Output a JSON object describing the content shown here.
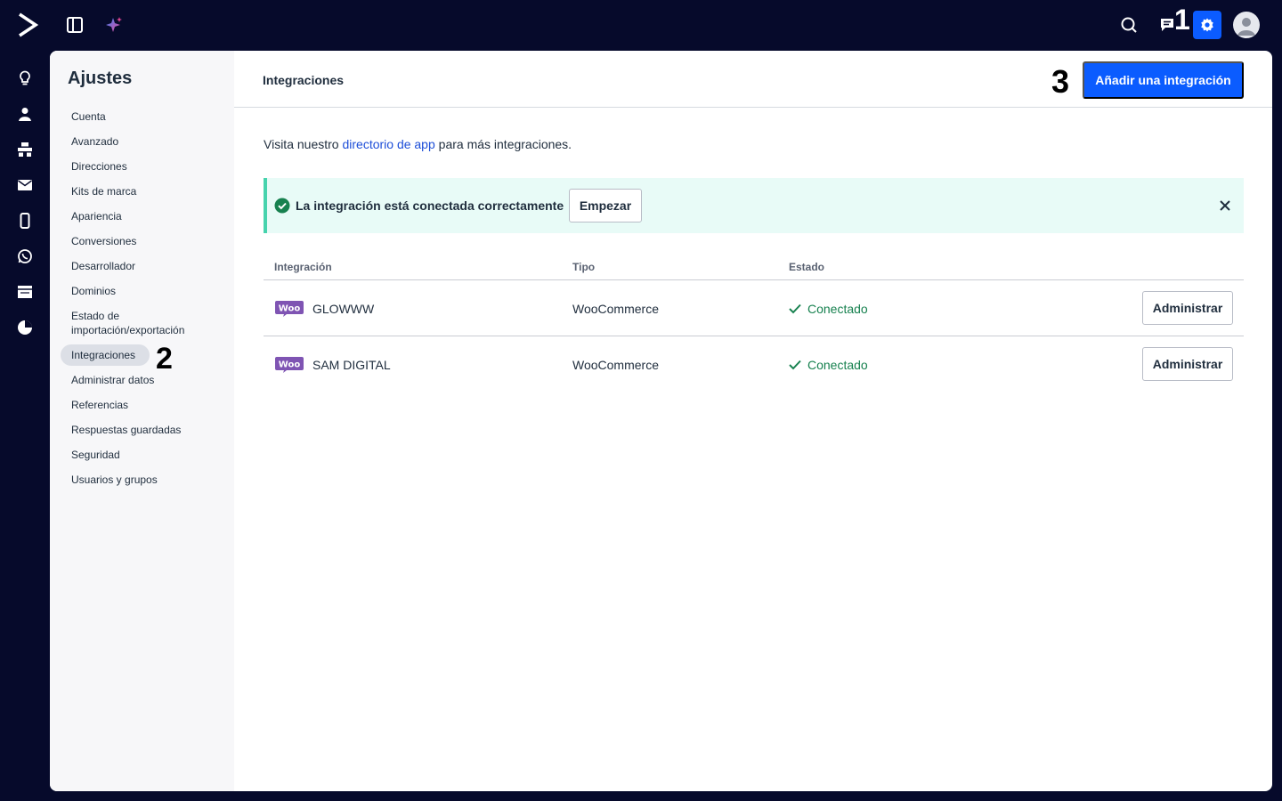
{
  "topbar": {
    "icons": [
      "logo-icon",
      "panel-toggle-icon",
      "sparkle-icon",
      "search-icon",
      "chat-icon",
      "gear-icon",
      "avatar-icon"
    ],
    "step_marker": "1",
    "accent_color": "#0b5cff",
    "background_color": "#060a2b"
  },
  "rail": {
    "icons": [
      "lightbulb-icon",
      "contacts-icon",
      "automations-icon",
      "campaigns-icon",
      "mobile-icon",
      "whatsapp-icon",
      "pages-icon",
      "reports-icon"
    ]
  },
  "sidebar": {
    "title": "Ajustes",
    "items": [
      {
        "label": "Cuenta"
      },
      {
        "label": "Avanzado"
      },
      {
        "label": "Direcciones"
      },
      {
        "label": "Kits de marca"
      },
      {
        "label": "Apariencia"
      },
      {
        "label": "Conversiones"
      },
      {
        "label": "Desarrollador"
      },
      {
        "label": "Dominios"
      },
      {
        "label": "Estado de importación/exportación"
      },
      {
        "label": "Integraciones",
        "active": true
      },
      {
        "label": "Administrar datos"
      },
      {
        "label": "Referencias"
      },
      {
        "label": "Respuestas guardadas"
      },
      {
        "label": "Seguridad"
      },
      {
        "label": "Usuarios y grupos"
      }
    ],
    "step_marker": "2"
  },
  "header": {
    "title": "Integraciones",
    "step_marker": "3",
    "add_button": "Añadir una integración"
  },
  "main": {
    "visit_prefix": "Visita nuestro",
    "visit_link": "directorio de app",
    "visit_suffix": "para más integraciones.",
    "alert": {
      "text": "La integración está conectada correctamente",
      "button": "Empezar",
      "color": "#46d3ad"
    },
    "table": {
      "columns": [
        "Integración",
        "Tipo",
        "Estado"
      ],
      "rows": [
        {
          "name": "GLOWWW",
          "type": "WooCommerce",
          "status": "Conectado",
          "action": "Administrar"
        },
        {
          "name": "SAM DIGITAL",
          "type": "WooCommerce",
          "status": "Conectado",
          "action": "Administrar"
        }
      ],
      "status_color": "#17814f",
      "woo_color": "#7f54b3"
    }
  }
}
